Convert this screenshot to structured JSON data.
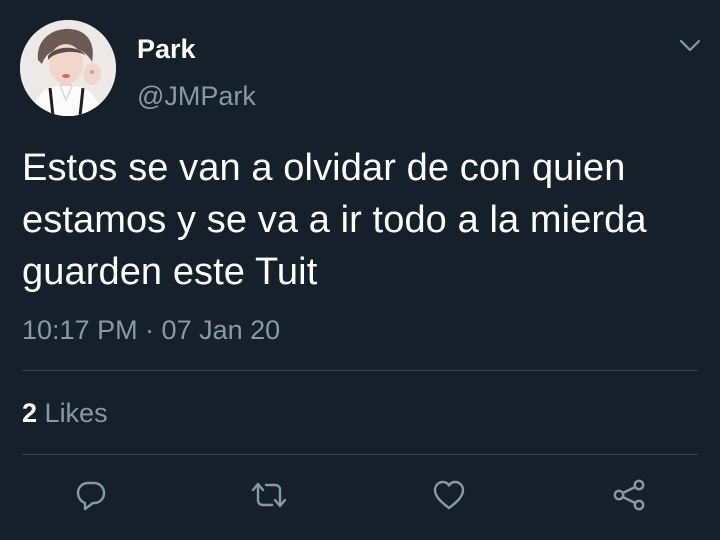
{
  "tweet": {
    "author": {
      "display_name": "Park",
      "handle": "@JMPark",
      "avatar_icon": "profile-photo"
    },
    "text": "Estos se van a olvidar de con quien estamos y se va a ir todo a la mierda guarden este Tuit",
    "timestamp": "10:17 PM · 07 Jan 20",
    "likes": {
      "count": "2",
      "label": "Likes"
    }
  },
  "actions": [
    "reply-icon",
    "retweet-icon",
    "like-icon",
    "share-icon"
  ],
  "colors": {
    "background": "#15202b",
    "primary_text": "#ffffff",
    "secondary_text": "#8899a6",
    "divider": "#38444d"
  }
}
